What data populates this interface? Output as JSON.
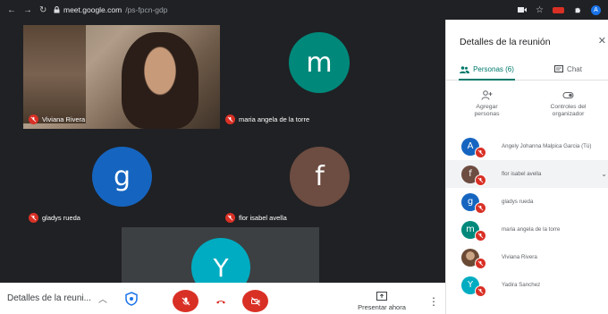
{
  "browser": {
    "url_host": "meet.google.com",
    "url_path": "/ps-fpcn-gdp",
    "profile_initial": "A"
  },
  "tiles": [
    {
      "name": "Viviana Rivera",
      "kind": "video"
    },
    {
      "name": "maria angela de la torre",
      "kind": "avatar",
      "initial": "m",
      "color": "#00897b"
    },
    {
      "name": "gladys rueda",
      "kind": "avatar",
      "initial": "g",
      "color": "#1565c0"
    },
    {
      "name": "flor isabel avella",
      "kind": "avatar",
      "initial": "f",
      "color": "#6d4c41"
    },
    {
      "name": "",
      "kind": "avatar",
      "initial": "Y",
      "color": "#00acc1"
    }
  ],
  "bottombar": {
    "details_label": "Detalles de la reuni...",
    "present_label": "Presentar ahora"
  },
  "panel": {
    "title": "Detalles de la reunión",
    "tabs": [
      {
        "label": "Personas (6)",
        "active": true
      },
      {
        "label": "Chat",
        "active": false
      }
    ],
    "actions": [
      {
        "label": "Agregar personas"
      },
      {
        "label": "Controles del organizador"
      }
    ],
    "participants": [
      {
        "name": "Angely Johanna Malpica Garcia (Tú)",
        "initial": "A",
        "color": "#1565c0"
      },
      {
        "name": "flor isabel avella",
        "initial": "f",
        "color": "#6d4c41"
      },
      {
        "name": "gladys rueda",
        "initial": "g",
        "color": "#1565c0"
      },
      {
        "name": "maria angela de la torre",
        "initial": "m",
        "color": "#00897b"
      },
      {
        "name": "Viviana Rivera",
        "initial": "",
        "color": "photo"
      },
      {
        "name": "Yadira Sanchez",
        "initial": "Y",
        "color": "#00acc1"
      }
    ]
  },
  "colors": {
    "stage": "#202124",
    "tile": "#3c4043",
    "danger": "#d93025",
    "accent": "#00796b"
  }
}
